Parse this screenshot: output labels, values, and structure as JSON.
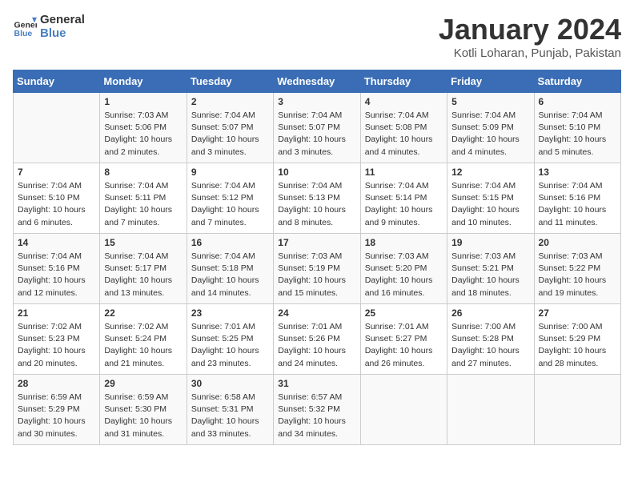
{
  "header": {
    "logo_line1": "General",
    "logo_line2": "Blue",
    "month": "January 2024",
    "location": "Kotli Loharan, Punjab, Pakistan"
  },
  "weekdays": [
    "Sunday",
    "Monday",
    "Tuesday",
    "Wednesday",
    "Thursday",
    "Friday",
    "Saturday"
  ],
  "weeks": [
    [
      {
        "day": "",
        "info": ""
      },
      {
        "day": "1",
        "info": "Sunrise: 7:03 AM\nSunset: 5:06 PM\nDaylight: 10 hours\nand 2 minutes."
      },
      {
        "day": "2",
        "info": "Sunrise: 7:04 AM\nSunset: 5:07 PM\nDaylight: 10 hours\nand 3 minutes."
      },
      {
        "day": "3",
        "info": "Sunrise: 7:04 AM\nSunset: 5:07 PM\nDaylight: 10 hours\nand 3 minutes."
      },
      {
        "day": "4",
        "info": "Sunrise: 7:04 AM\nSunset: 5:08 PM\nDaylight: 10 hours\nand 4 minutes."
      },
      {
        "day": "5",
        "info": "Sunrise: 7:04 AM\nSunset: 5:09 PM\nDaylight: 10 hours\nand 4 minutes."
      },
      {
        "day": "6",
        "info": "Sunrise: 7:04 AM\nSunset: 5:10 PM\nDaylight: 10 hours\nand 5 minutes."
      }
    ],
    [
      {
        "day": "7",
        "info": "Sunrise: 7:04 AM\nSunset: 5:10 PM\nDaylight: 10 hours\nand 6 minutes."
      },
      {
        "day": "8",
        "info": "Sunrise: 7:04 AM\nSunset: 5:11 PM\nDaylight: 10 hours\nand 7 minutes."
      },
      {
        "day": "9",
        "info": "Sunrise: 7:04 AM\nSunset: 5:12 PM\nDaylight: 10 hours\nand 7 minutes."
      },
      {
        "day": "10",
        "info": "Sunrise: 7:04 AM\nSunset: 5:13 PM\nDaylight: 10 hours\nand 8 minutes."
      },
      {
        "day": "11",
        "info": "Sunrise: 7:04 AM\nSunset: 5:14 PM\nDaylight: 10 hours\nand 9 minutes."
      },
      {
        "day": "12",
        "info": "Sunrise: 7:04 AM\nSunset: 5:15 PM\nDaylight: 10 hours\nand 10 minutes."
      },
      {
        "day": "13",
        "info": "Sunrise: 7:04 AM\nSunset: 5:16 PM\nDaylight: 10 hours\nand 11 minutes."
      }
    ],
    [
      {
        "day": "14",
        "info": "Sunrise: 7:04 AM\nSunset: 5:16 PM\nDaylight: 10 hours\nand 12 minutes."
      },
      {
        "day": "15",
        "info": "Sunrise: 7:04 AM\nSunset: 5:17 PM\nDaylight: 10 hours\nand 13 minutes."
      },
      {
        "day": "16",
        "info": "Sunrise: 7:04 AM\nSunset: 5:18 PM\nDaylight: 10 hours\nand 14 minutes."
      },
      {
        "day": "17",
        "info": "Sunrise: 7:03 AM\nSunset: 5:19 PM\nDaylight: 10 hours\nand 15 minutes."
      },
      {
        "day": "18",
        "info": "Sunrise: 7:03 AM\nSunset: 5:20 PM\nDaylight: 10 hours\nand 16 minutes."
      },
      {
        "day": "19",
        "info": "Sunrise: 7:03 AM\nSunset: 5:21 PM\nDaylight: 10 hours\nand 18 minutes."
      },
      {
        "day": "20",
        "info": "Sunrise: 7:03 AM\nSunset: 5:22 PM\nDaylight: 10 hours\nand 19 minutes."
      }
    ],
    [
      {
        "day": "21",
        "info": "Sunrise: 7:02 AM\nSunset: 5:23 PM\nDaylight: 10 hours\nand 20 minutes."
      },
      {
        "day": "22",
        "info": "Sunrise: 7:02 AM\nSunset: 5:24 PM\nDaylight: 10 hours\nand 21 minutes."
      },
      {
        "day": "23",
        "info": "Sunrise: 7:01 AM\nSunset: 5:25 PM\nDaylight: 10 hours\nand 23 minutes."
      },
      {
        "day": "24",
        "info": "Sunrise: 7:01 AM\nSunset: 5:26 PM\nDaylight: 10 hours\nand 24 minutes."
      },
      {
        "day": "25",
        "info": "Sunrise: 7:01 AM\nSunset: 5:27 PM\nDaylight: 10 hours\nand 26 minutes."
      },
      {
        "day": "26",
        "info": "Sunrise: 7:00 AM\nSunset: 5:28 PM\nDaylight: 10 hours\nand 27 minutes."
      },
      {
        "day": "27",
        "info": "Sunrise: 7:00 AM\nSunset: 5:29 PM\nDaylight: 10 hours\nand 28 minutes."
      }
    ],
    [
      {
        "day": "28",
        "info": "Sunrise: 6:59 AM\nSunset: 5:29 PM\nDaylight: 10 hours\nand 30 minutes."
      },
      {
        "day": "29",
        "info": "Sunrise: 6:59 AM\nSunset: 5:30 PM\nDaylight: 10 hours\nand 31 minutes."
      },
      {
        "day": "30",
        "info": "Sunrise: 6:58 AM\nSunset: 5:31 PM\nDaylight: 10 hours\nand 33 minutes."
      },
      {
        "day": "31",
        "info": "Sunrise: 6:57 AM\nSunset: 5:32 PM\nDaylight: 10 hours\nand 34 minutes."
      },
      {
        "day": "",
        "info": ""
      },
      {
        "day": "",
        "info": ""
      },
      {
        "day": "",
        "info": ""
      }
    ]
  ]
}
